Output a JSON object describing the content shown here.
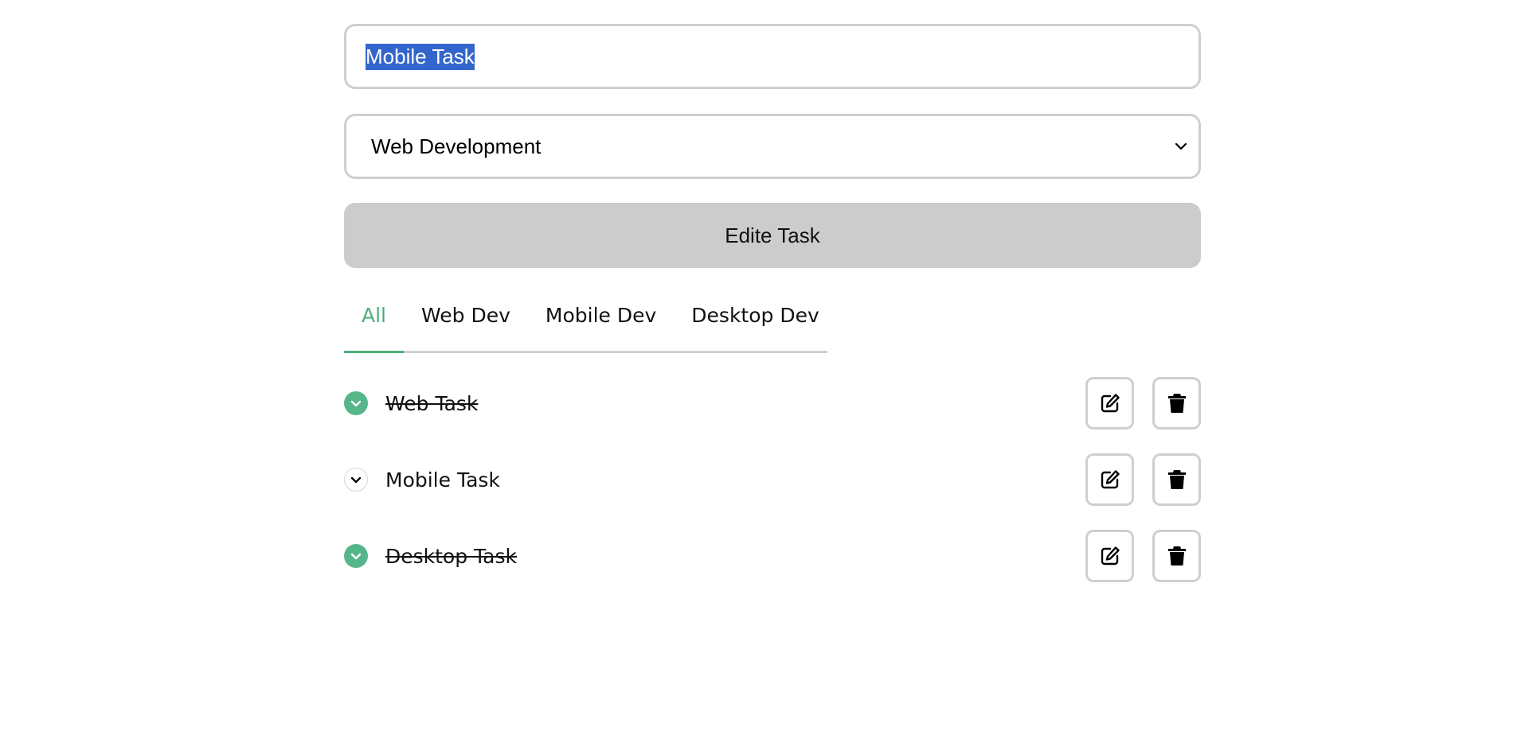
{
  "form": {
    "task_input_value": "Mobile Task",
    "category_selected": "Web Development",
    "submit_label": "Edite Task"
  },
  "tabs": [
    {
      "label": "All",
      "active": true
    },
    {
      "label": "Web Dev",
      "active": false
    },
    {
      "label": "Mobile Dev",
      "active": false
    },
    {
      "label": "Desktop Dev",
      "active": false
    }
  ],
  "tasks": [
    {
      "name": "Web Task",
      "completed": true
    },
    {
      "name": "Mobile Task",
      "completed": false
    },
    {
      "name": "Desktop Task",
      "completed": true
    }
  ],
  "colors": {
    "accent": "#4caf7d",
    "check_done": "#55b68a",
    "selection": "#3366cc",
    "button_bg": "#cccccc",
    "border": "#cfcfcf"
  },
  "icons": {
    "edit": "edit-icon",
    "delete": "trash-icon",
    "check": "chevron-down-icon",
    "select": "chevron-down-icon"
  }
}
